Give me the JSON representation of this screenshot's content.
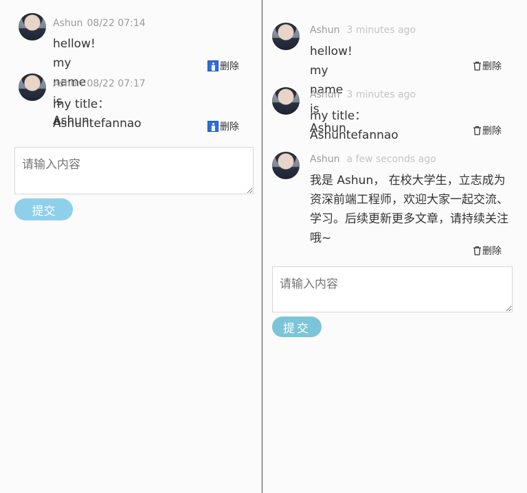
{
  "left": {
    "comments": [
      {
        "author": "Ashun",
        "time": "08/22 07:14",
        "text": "hellow! my name is Ashun.",
        "delete_label": "删除"
      },
      {
        "author": "Ashun",
        "time": "08/22 07:17",
        "text": "my title：Ashuntefannao",
        "delete_label": "删除"
      }
    ],
    "input_placeholder": "请输入内容",
    "submit_label": "提交"
  },
  "right": {
    "comments": [
      {
        "author": "Ashun",
        "time": "3 minutes ago",
        "text": "hellow! my name is Ashun.",
        "delete_label": "删除"
      },
      {
        "author": "Ashun",
        "time": "3 minutes ago",
        "text": "my title：Ashuntefannao",
        "delete_label": "删除"
      },
      {
        "author": "Ashun",
        "time": "a few seconds ago",
        "text": "我是 Ashun， 在校大学生，立志成为资深前端工程师，欢迎大家一起交流、学习。后续更新更多文章，请持续关注哦~",
        "delete_label": "删除"
      }
    ],
    "input_placeholder": "请输入内容",
    "submit_label": "提交"
  }
}
